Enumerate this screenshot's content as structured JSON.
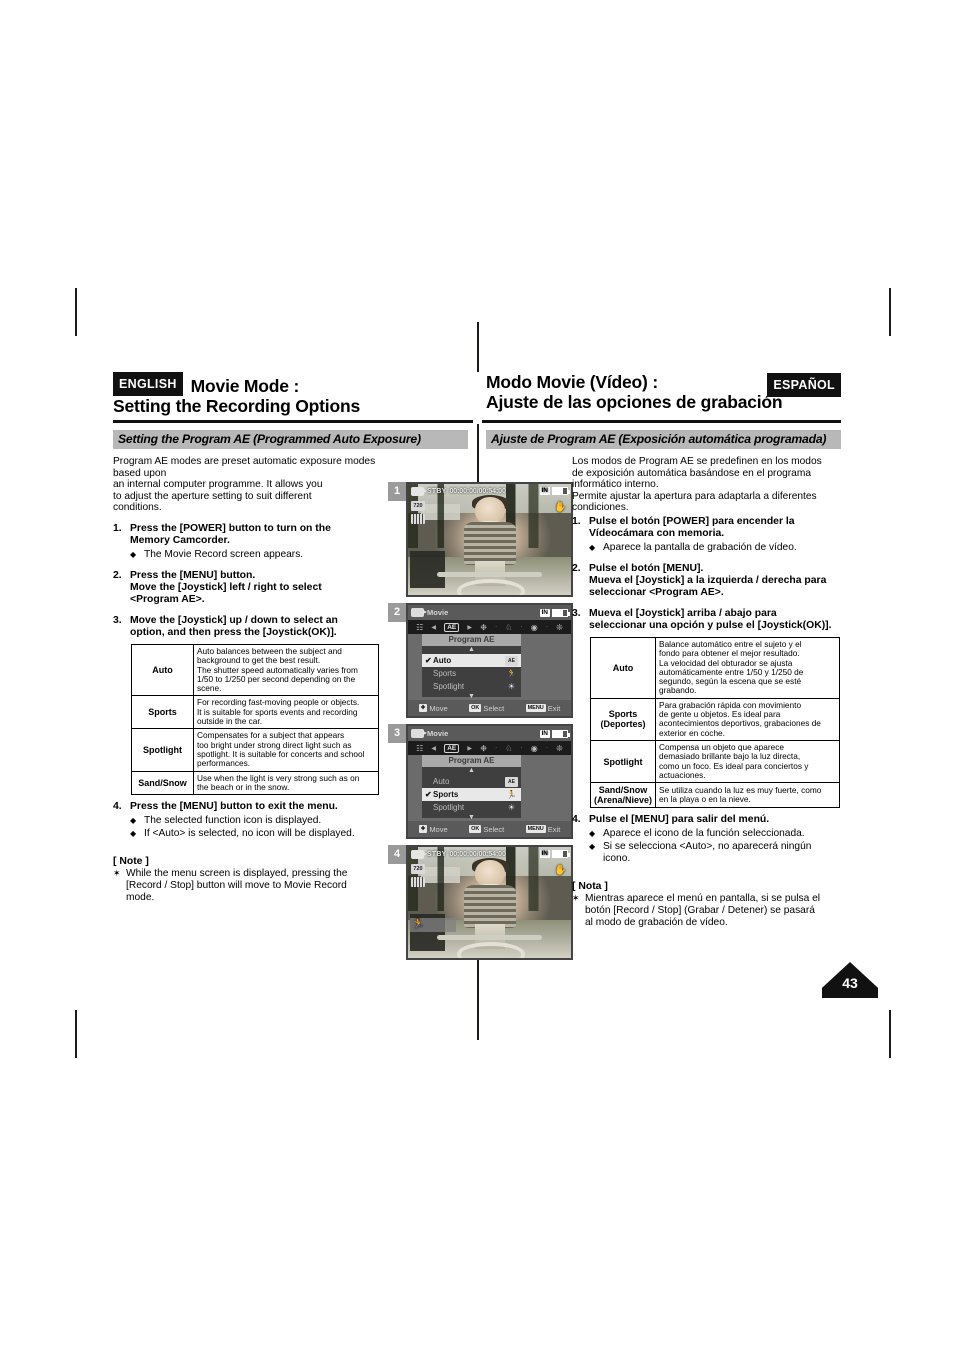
{
  "header": {
    "english_badge": "ENGLISH",
    "spanish_badge": "ESPAÑOL",
    "en_title_line1": "Movie Mode :",
    "en_title_line2": "Setting the Recording Options",
    "es_title_line1": "Modo Movie (Vídeo) :",
    "es_title_line2": "Ajuste de las opciones de grabación"
  },
  "subbars": {
    "en": "Setting the Program AE (Programmed Auto Exposure)",
    "es": "Ajuste de Program AE (Exposición automática programada)"
  },
  "english": {
    "intro": [
      "Program AE modes are preset automatic exposure modes based upon",
      "an internal computer programme. It allows you",
      "to adjust the aperture setting to suit different",
      "conditions."
    ],
    "steps": [
      {
        "num": "1.",
        "head": [
          "Press the [POWER] button to turn on the",
          "Memory Camcorder."
        ],
        "bullets": [
          [
            "The Movie Record screen appears."
          ]
        ]
      },
      {
        "num": "2.",
        "head": [
          "Press the [MENU] button.",
          "Move the [Joystick] left / right to select",
          "<Program AE>."
        ],
        "bullets": []
      },
      {
        "num": "3.",
        "head": [
          "Move the [Joystick] up / down to select an",
          "option, and then press the [Joystick(OK)]."
        ],
        "bullets": []
      },
      {
        "num": "4.",
        "head": [
          "Press the [MENU] button to exit the menu."
        ],
        "bullets": [
          [
            "The selected function icon is displayed."
          ],
          [
            "If <Auto> is selected, no icon will be displayed."
          ]
        ]
      }
    ],
    "table": [
      {
        "name": "Auto",
        "desc": [
          "Auto balances between the subject and",
          "background to get the best result.",
          "The shutter speed automatically varies from",
          "1/50 to 1/250 per second depending on the",
          "scene."
        ]
      },
      {
        "name": "Sports",
        "desc": [
          "For recording fast-moving people or objects.",
          "It is suitable for sports events and recording",
          "outside in the car."
        ]
      },
      {
        "name": "Spotlight",
        "desc": [
          "Compensates for a subject that appears",
          "too bright under strong direct light such as",
          "spotlight. It is suitable for concerts and school",
          "performances."
        ]
      },
      {
        "name": "Sand/Snow",
        "desc": [
          "Use when the light is very strong such as on",
          "the beach or in the snow."
        ]
      }
    ],
    "note_title": "[ Note ]",
    "note": [
      "While the menu screen is displayed, pressing the",
      "[Record / Stop] button will move to Movie Record",
      "mode."
    ]
  },
  "spanish": {
    "intro": [
      "Los modos de Program AE se predefinen en los modos",
      "de exposición automática basándose en el programa",
      "informático interno.",
      "Permite ajustar la apertura para adaptarla a diferentes",
      "condiciones."
    ],
    "steps": [
      {
        "num": "1.",
        "head": [
          "Pulse el botón [POWER] para encender la",
          "Vídeocámara con memoria."
        ],
        "bullets": [
          [
            "Aparece la pantalla de grabación de vídeo."
          ]
        ]
      },
      {
        "num": "2.",
        "head": [
          "Pulse el botón [MENU].",
          "Mueva el [Joystick] a la izquierda / derecha para",
          "seleccionar <Program AE>."
        ],
        "bullets": []
      },
      {
        "num": "3.",
        "head": [
          "Mueva el [Joystick] arriba / abajo para",
          "seleccionar una opción y pulse el [Joystick(OK)]."
        ],
        "bullets": []
      },
      {
        "num": "4.",
        "head": [
          "Pulse el [MENU] para salir del menú."
        ],
        "bullets": [
          [
            "Aparece el icono de la función seleccionada."
          ],
          [
            "Si se selecciona <Auto>, no aparecerá ningún",
            "icono."
          ]
        ]
      }
    ],
    "table": [
      {
        "name": "Auto",
        "name2": "",
        "desc": [
          "Balance automático entre el sujeto y el",
          "fondo para obtener el mejor resultado.",
          "La velocidad del obturador se ajusta",
          "automáticamente entre 1/50 y 1/250 de",
          "segundo, según la escena que se esté",
          "grabando."
        ]
      },
      {
        "name": "Sports",
        "name2": "(Deportes)",
        "desc": [
          "Para grabación rápida con movimiento",
          "de gente u objetos. Es ideal para",
          "acontecimientos deportivos, grabaciones de",
          "exterior en coche."
        ]
      },
      {
        "name": "Spotlight",
        "name2": "",
        "desc": [
          "Compensa un objeto que aparece",
          "demasiado brillante bajo la luz directa,",
          "como un foco. Es ideal para conciertos y",
          "actuaciones."
        ]
      },
      {
        "name": "Sand/Snow",
        "name2": "(Arena/Nieve)",
        "desc": [
          "Se utiliza cuando la luz es muy fuerte, como",
          "en la playa o en la nieve."
        ]
      }
    ],
    "note_title": "[ Nota ]",
    "note": [
      "Mientras aparece el menú en pantalla, si se pulsa el",
      "botón [Record / Stop] (Grabar / Detener) se pasará",
      "al modo de grabación de vídeo."
    ]
  },
  "screens": {
    "badge1": "1",
    "badge2": "2",
    "badge3": "3",
    "badge4": "4",
    "rec": {
      "stby": "STBY",
      "timecode": "00:00:00/00:54:00",
      "in_label": "IN",
      "chip_720": "720",
      "hand_icon": "steady-hand-icon",
      "cam_icon": "camcorder-icon"
    },
    "menu": {
      "title": "Movie",
      "in_label": "IN",
      "submenu_title": "Program AE",
      "items": [
        "Auto",
        "Sports",
        "Spotlight"
      ],
      "bottom": [
        {
          "key": "joystick-icon",
          "label": "Move"
        },
        {
          "key": "OK",
          "label": "Select"
        },
        {
          "key": "MENU",
          "label": "Exit"
        }
      ],
      "icon_row": [
        "resolution-icon",
        "AE",
        "white-balance-icon",
        "bls-icon",
        "focus-icon",
        "effect-icon"
      ],
      "selected_screen2": "Auto",
      "selected_screen3": "Sports"
    }
  },
  "page_number": "43",
  "colors": {
    "badge_bg": "#111111",
    "subbar_bg": "#b8b8b8",
    "step_badge_bg": "#9a9a9a"
  }
}
